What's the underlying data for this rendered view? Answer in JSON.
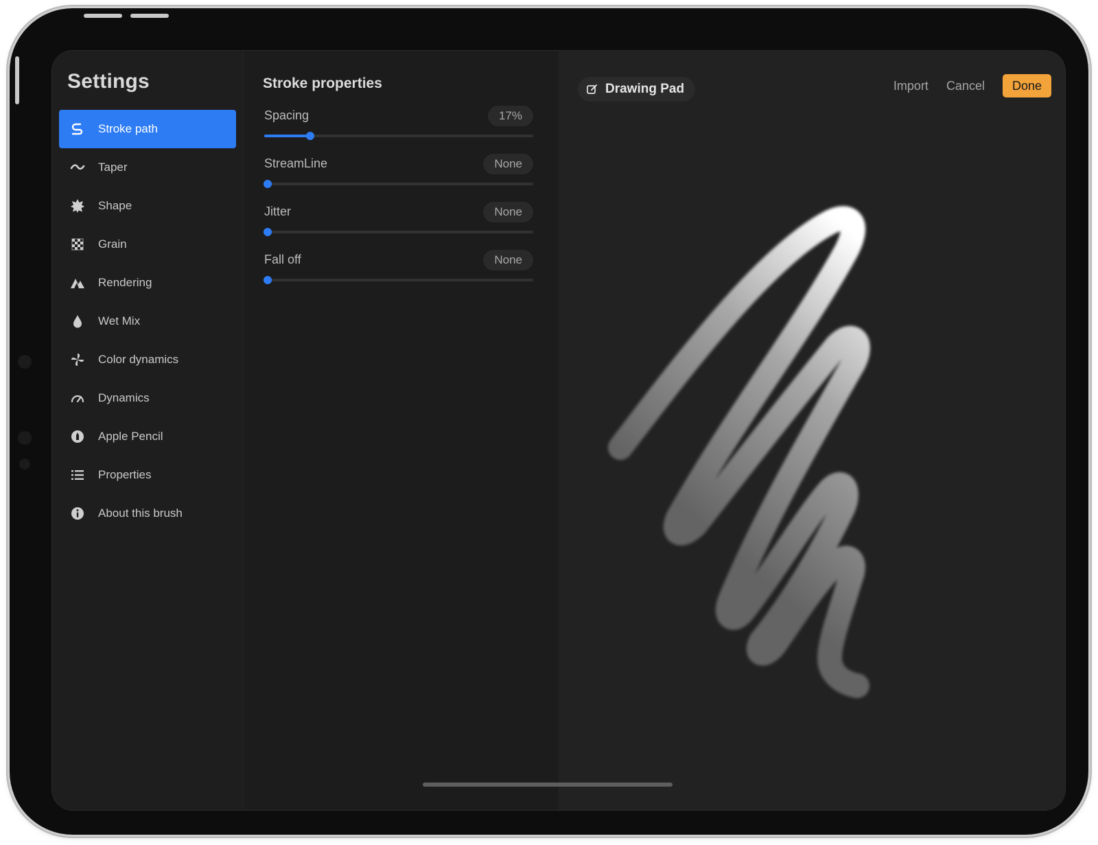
{
  "sidebar": {
    "title": "Settings",
    "items": [
      {
        "label": "Stroke path",
        "icon": "stroke-path-icon",
        "active": true
      },
      {
        "label": "Taper",
        "icon": "taper-icon",
        "active": false
      },
      {
        "label": "Shape",
        "icon": "shape-icon",
        "active": false
      },
      {
        "label": "Grain",
        "icon": "grain-icon",
        "active": false
      },
      {
        "label": "Rendering",
        "icon": "rendering-icon",
        "active": false
      },
      {
        "label": "Wet Mix",
        "icon": "wet-mix-icon",
        "active": false
      },
      {
        "label": "Color dynamics",
        "icon": "color-dynamics-icon",
        "active": false
      },
      {
        "label": "Dynamics",
        "icon": "dynamics-icon",
        "active": false
      },
      {
        "label": "Apple Pencil",
        "icon": "apple-pencil-icon",
        "active": false
      },
      {
        "label": "Properties",
        "icon": "properties-icon",
        "active": false
      },
      {
        "label": "About this brush",
        "icon": "info-icon",
        "active": false
      }
    ]
  },
  "stroke_properties": {
    "title": "Stroke properties",
    "sliders": [
      {
        "label": "Spacing",
        "value": "17%",
        "fraction": 0.17
      },
      {
        "label": "StreamLine",
        "value": "None",
        "fraction": 0.0
      },
      {
        "label": "Jitter",
        "value": "None",
        "fraction": 0.0
      },
      {
        "label": "Fall off",
        "value": "None",
        "fraction": 0.0
      }
    ]
  },
  "drawing_pad": {
    "title": "Drawing Pad",
    "import_label": "Import",
    "cancel_label": "Cancel",
    "done_label": "Done"
  },
  "colors": {
    "accent": "#2d7cf4",
    "done": "#f2a33a",
    "background": "#1d1d1d"
  }
}
